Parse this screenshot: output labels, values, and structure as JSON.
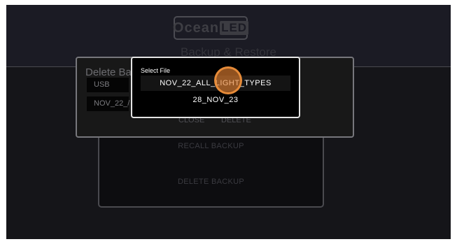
{
  "header": {
    "logo_text": "Ocean",
    "logo_badge": "LED",
    "page_title": "Backup & Restore"
  },
  "backup_panel": {
    "recall_label": "RECALL BACKUP",
    "delete_label": "DELETE BACKUP"
  },
  "delete_dialog": {
    "title": "Delete Ba",
    "source_value": "USB",
    "file_value": "NOV_22_/",
    "close_label": "CLOSE",
    "delete_label": "DELETE"
  },
  "select_dialog": {
    "title": "Select File",
    "files": [
      "NOV_22_ALL_LIGHT_TYPES",
      "28_NOV_23"
    ]
  },
  "touch_indicator": {
    "color": "#e8823c"
  }
}
